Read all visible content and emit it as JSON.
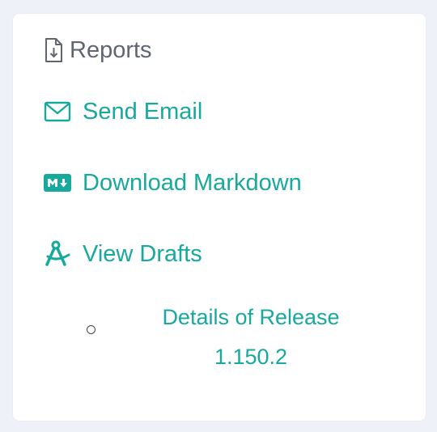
{
  "reports": {
    "title": "Reports",
    "header_icon": "file-download-icon",
    "actions": [
      {
        "label": "Send Email",
        "icon": "envelope-icon"
      },
      {
        "label": "Download Markdown",
        "icon": "markdown-icon"
      },
      {
        "label": "View Drafts",
        "icon": "compass-drafting-icon"
      }
    ],
    "drafts": [
      {
        "label": "Details of Release 1.150.2",
        "selected": false
      }
    ]
  },
  "colors": {
    "accent": "#17a89e",
    "heading": "#5f6670",
    "background": "#eef1f8",
    "card": "#ffffff"
  }
}
